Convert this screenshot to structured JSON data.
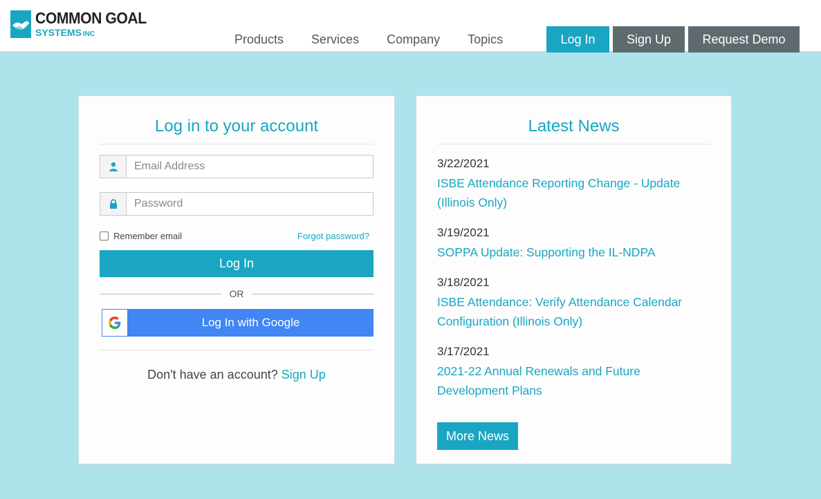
{
  "brand": {
    "line1": "COMMON GOAL",
    "line2": "SYSTEMS",
    "suffix": "INC"
  },
  "nav": [
    "Products",
    "Services",
    "Company",
    "Topics"
  ],
  "header_buttons": {
    "login": "Log In",
    "signup": "Sign Up",
    "demo": "Request Demo"
  },
  "login": {
    "title": "Log in to your account",
    "email_placeholder": "Email Address",
    "password_placeholder": "Password",
    "remember_label": "Remember email",
    "forgot_link": "Forgot password?",
    "submit": "Log In",
    "or_text": "OR",
    "google_button": "Log In with Google",
    "no_account_text": "Don't have an account?",
    "signup_link": "Sign Up"
  },
  "news": {
    "title": "Latest News",
    "items": [
      {
        "date": "3/22/2021",
        "title": "ISBE Attendance Reporting Change - Update (Illinois Only)"
      },
      {
        "date": "3/19/2021",
        "title": "SOPPA Update: Supporting the IL-NDPA"
      },
      {
        "date": "3/18/2021",
        "title": "ISBE Attendance: Verify Attendance Calendar Configuration (Illinois Only)"
      },
      {
        "date": "3/17/2021",
        "title": "2021-22 Annual Renewals and Future Development Plans"
      }
    ],
    "more_button": "More News"
  },
  "colors": {
    "accent": "#1aa6c2",
    "background": "#ade4ec",
    "dark_button": "#5f6a6f",
    "google_blue": "#4285f4"
  }
}
